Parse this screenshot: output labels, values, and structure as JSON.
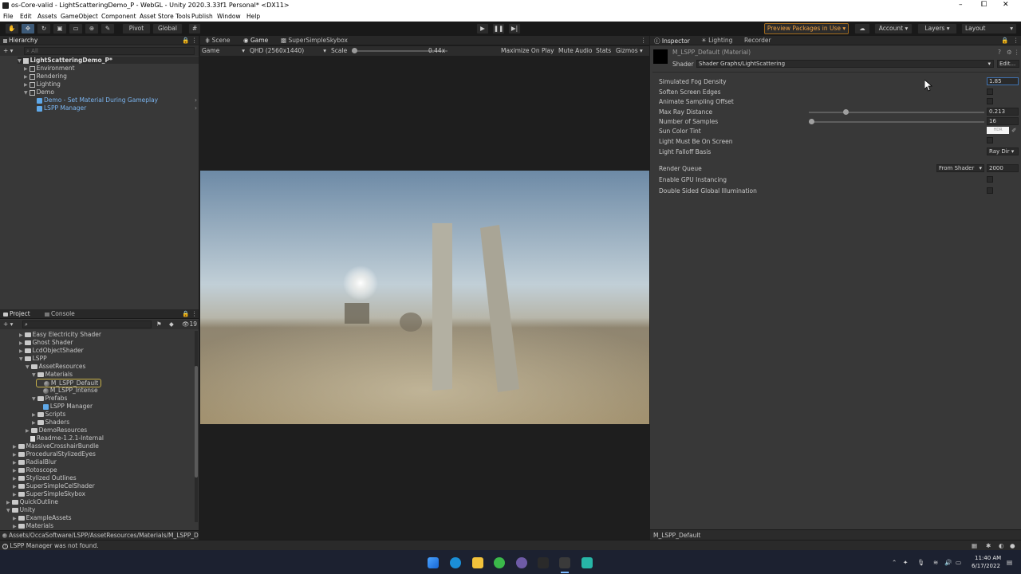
{
  "window": {
    "title": "os-Core-valid - LightScatteringDemo_P - WebGL - Unity 2020.3.33f1 Personal* <DX11>",
    "controls": [
      "–",
      "⧠",
      "✕"
    ]
  },
  "menu": [
    "File",
    "Edit",
    "Assets",
    "GameObject",
    "Component",
    "Asset Store Tools",
    "Publish",
    "Window",
    "Help"
  ],
  "toolbar": {
    "pivot": "Pivot",
    "global": "Global",
    "preview_packages": "Preview Packages in Use ▾",
    "account": "Account",
    "layers": "Layers",
    "layout": "Layout"
  },
  "hierarchy": {
    "tab": "Hierarchy",
    "search_placeholder": "All",
    "scene": "LightScatteringDemo_P*",
    "items": [
      {
        "label": "Environment"
      },
      {
        "label": "Rendering"
      },
      {
        "label": "Lighting"
      },
      {
        "label": "Demo"
      },
      {
        "label": "Demo - Set Material During Gameplay"
      },
      {
        "label": "LSPP Manager"
      }
    ]
  },
  "view": {
    "tabs": [
      "Scene",
      "Game",
      "SuperSimpleSkybox"
    ],
    "display": "Game",
    "resolution": "QHD (2560x1440)",
    "scale_label": "Scale",
    "scale_value": "0.44x",
    "maximize": "Maximize On Play",
    "mute": "Mute Audio",
    "stats": "Stats",
    "gizmos": "Gizmos"
  },
  "project": {
    "tabs": [
      "Project",
      "Console"
    ],
    "count": "19",
    "items": [
      {
        "label": "Easy Electricity Shader"
      },
      {
        "label": "Ghost Shader"
      },
      {
        "label": "LcdObjectShader"
      },
      {
        "label": "LSPP"
      },
      {
        "label": "AssetResources"
      },
      {
        "label": "Materials"
      },
      {
        "label": "M_LSPP_Default"
      },
      {
        "label": "M_LSPP_Intense"
      },
      {
        "label": "Prefabs"
      },
      {
        "label": "LSPP Manager"
      },
      {
        "label": "Scripts"
      },
      {
        "label": "Shaders"
      },
      {
        "label": "DemoResources"
      },
      {
        "label": "Readme-1.2.1-Internal"
      },
      {
        "label": "MassiveCrosshairBundle"
      },
      {
        "label": "ProceduralStylizedEyes"
      },
      {
        "label": "RadialBlur"
      },
      {
        "label": "Rotoscope"
      },
      {
        "label": "Stylized Outlines"
      },
      {
        "label": "SuperSimpleCelShader"
      },
      {
        "label": "SuperSimpleSkybox"
      },
      {
        "label": "QuickOutline"
      },
      {
        "label": "Unity"
      },
      {
        "label": "ExampleAssets"
      },
      {
        "label": "Materials"
      }
    ],
    "path": "Assets/OccaSoftware/LSPP/AssetResources/Materials/M_LSPP_D"
  },
  "inspector": {
    "tabs": [
      "Inspector",
      "Lighting",
      "Recorder"
    ],
    "material_name": "M_LSPP_Default (Material)",
    "shader_label": "Shader",
    "shader_value": "Shader Graphs/LightScattering",
    "edit": "Edit...",
    "props": [
      {
        "label": "Simulated Fog Density",
        "value": "1.85"
      },
      {
        "label": "Soften Screen Edges",
        "value": ""
      },
      {
        "label": "Animate Sampling Offset",
        "value": ""
      },
      {
        "label": "Max Ray Distance",
        "value": "0.213"
      },
      {
        "label": "Number of Samples",
        "value": "16"
      },
      {
        "label": "Sun Color Tint",
        "value": "HDR"
      },
      {
        "label": "Light Must Be On Screen",
        "value": ""
      },
      {
        "label": "Light Falloff Basis",
        "value": "Ray Dir ▾"
      }
    ],
    "render_queue": {
      "label": "Render Queue",
      "mode": "From Shader",
      "value": "2000"
    },
    "gpu_instancing": "Enable GPU Instancing",
    "double_sided": "Double Sided Global Illumination",
    "footer": "M_LSPP_Default",
    "slider_max_ray": 0.2,
    "slider_samples": 0.0
  },
  "status": {
    "message": "LSPP Manager was not found."
  },
  "taskbar": {
    "time": "11:40 AM",
    "date": "6/17/2022"
  }
}
